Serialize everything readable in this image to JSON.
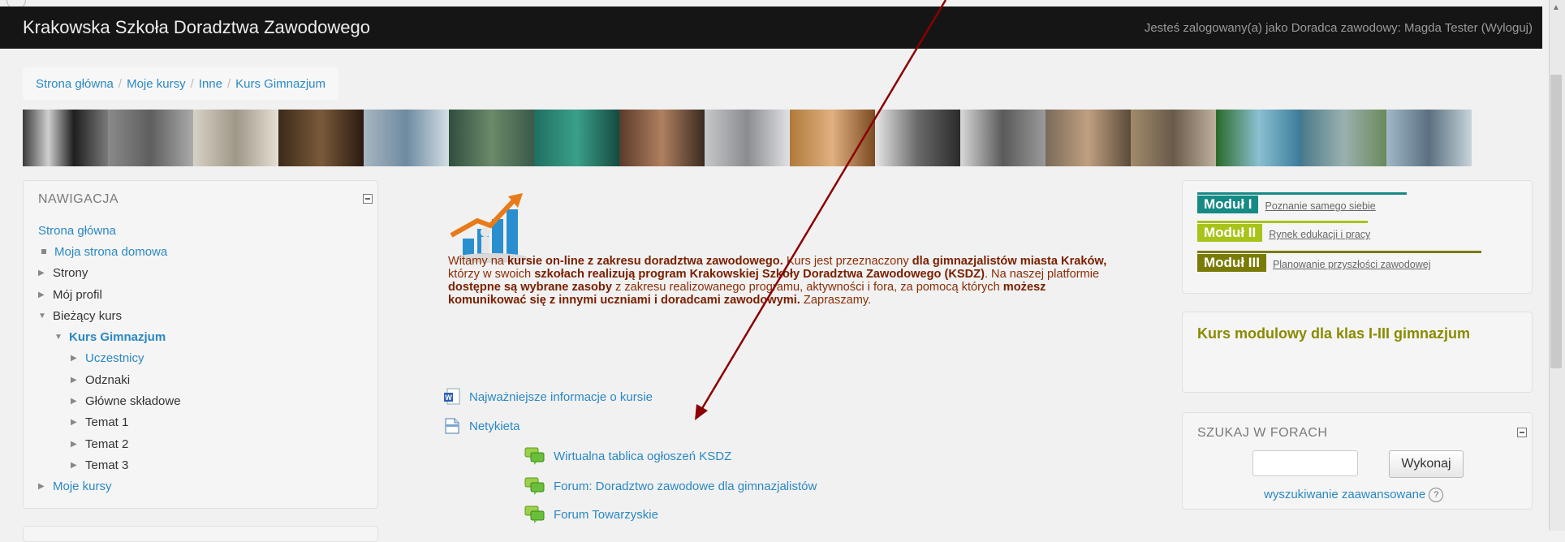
{
  "header": {
    "site_title": "Krakowska Szkoła Doradztwa Zawodowego",
    "login_prefix": "Jesteś zalogowany(a) jako Doradca zawodowy: Magda Tester (",
    "logout_label": "Wyloguj",
    "login_suffix": ")"
  },
  "breadcrumb": {
    "items": [
      "Strona główna",
      "Moje kursy",
      "Inne",
      "Kurs Gimnazjum"
    ],
    "separator": "/"
  },
  "navigation": {
    "heading": "NAWIGACJA",
    "items": [
      {
        "label": "Strona główna"
      },
      {
        "label": "Moja strona domowa"
      },
      {
        "label": "Strony"
      },
      {
        "label": "Mój profil"
      },
      {
        "label": "Bieżący kurs"
      },
      {
        "label": "Kurs Gimnazjum"
      },
      {
        "label": "Uczestnicy"
      },
      {
        "label": "Odznaki"
      },
      {
        "label": "Główne składowe"
      },
      {
        "label": "Temat 1"
      },
      {
        "label": "Temat 2"
      },
      {
        "label": "Temat 3"
      },
      {
        "label": "Moje kursy"
      }
    ]
  },
  "intro": {
    "t1": "Witamy na ",
    "b1": "kursie on-line z zakresu doradztwa zawodowego.",
    "t2": " Kurs jest przeznaczony ",
    "b2": "dla gimnazjalistów miasta Kraków,",
    "t3": " którzy w swoich ",
    "b3": "szkołach realizują program Krakowskiej Szkoły  Doradztwa Zawodowego (KSDZ)",
    "t4": ". Na naszej platformie ",
    "b4": "dostępne są wybrane zasoby",
    "t5": " z zakresu realizowanego programu, aktywności i fora, za pomocą których ",
    "b5": "możesz komunikować się z innymi uczniami i doradcami zawodowymi.",
    "t6": " Zapraszamy."
  },
  "activities": {
    "info": "Najważniejsze informacje o kursie",
    "netykieta": "Netykieta",
    "forum1": "Wirtualna tablica ogłoszeń KSDZ",
    "forum2": "Forum: Doradztwo zawodowe dla gimnazjalistów",
    "forum3": "Forum Towarzyskie"
  },
  "modules": [
    {
      "tag": "Moduł I",
      "link": "Poznanie samego siebie",
      "color": "#178a86"
    },
    {
      "tag": "Moduł II",
      "link": "Rynek edukacji i pracy",
      "color": "#a8c41a"
    },
    {
      "tag": "Moduł III",
      "link": "Planowanie przyszłości zawodowej",
      "color": "#7a7b06"
    }
  ],
  "course_block": {
    "title": "Kurs modulowy dla klas I-III gimnazjum"
  },
  "search": {
    "heading": "SZUKAJ W FORACH",
    "input_value": "",
    "button_label": "Wykonaj",
    "advanced_label": "wyszukiwanie zaawansowane",
    "help_glyph": "?"
  },
  "colors": {
    "topbar": "#151515",
    "link": "#2a88c4",
    "intro_text": "#8b2d05",
    "annotation_arrow": "#8b0000"
  },
  "icons": {
    "banner": "photo-collage",
    "main": "growth-chart-illustration",
    "collapse": "minus-square-icon",
    "info": "word-document-icon",
    "page": "page-icon",
    "forum": "forum-icon",
    "help": "help-icon"
  }
}
